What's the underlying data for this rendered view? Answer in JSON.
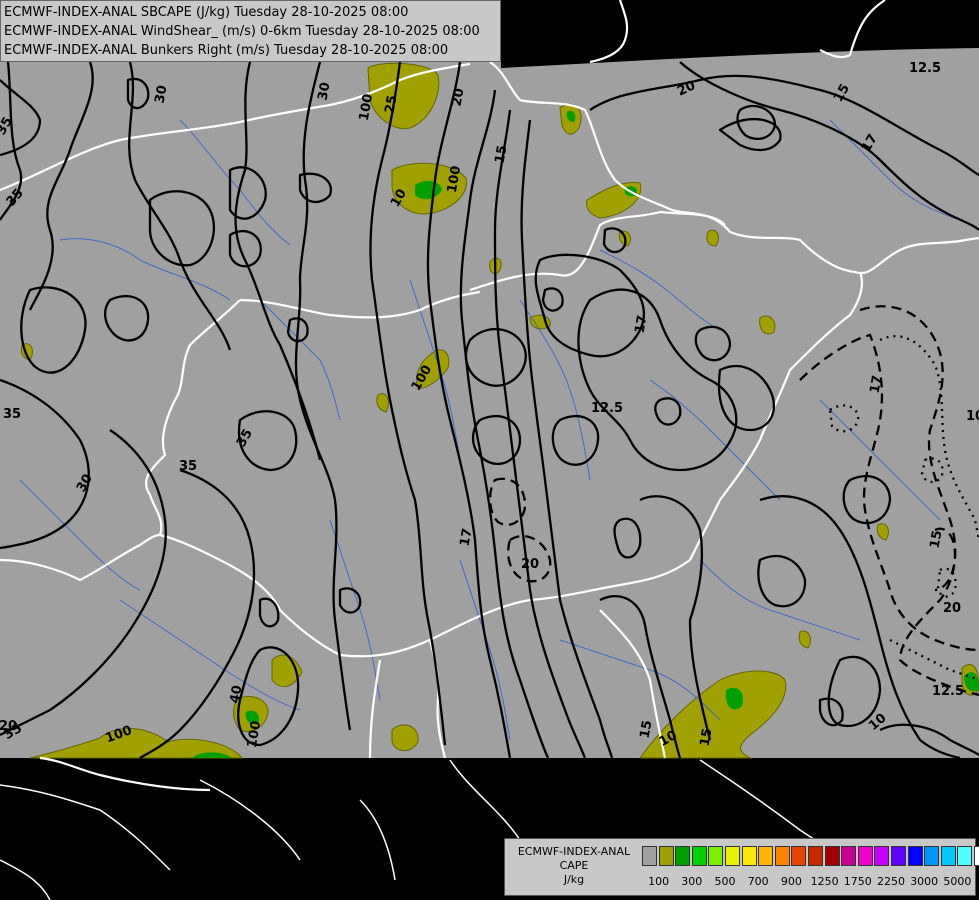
{
  "title_lines": [
    "ECMWF-INDEX-ANAL SBCAPE (J/kg) Tuesday 28-10-2025 08:00",
    "ECMWF-INDEX-ANAL WindShear_ (m/s) 0-6km Tuesday 28-10-2025 08:00",
    "ECMWF-INDEX-ANAL Bunkers Right (m/s) Tuesday 28-10-2025 08:00"
  ],
  "legend": {
    "title_lines": [
      "ECMWF-INDEX-ANAL",
      "CAPE",
      "J/kg"
    ],
    "colors": [
      "#a0a0a0",
      "#a0a000",
      "#00a000",
      "#00d200",
      "#78f000",
      "#e6f000",
      "#ffe600",
      "#ffb400",
      "#ff8200",
      "#e64600",
      "#c82800",
      "#a00000",
      "#c80096",
      "#f000c8",
      "#c800ff",
      "#6400ff",
      "#0000ff",
      "#0096ff",
      "#00c8ff",
      "#50ffff",
      "#ffffff"
    ],
    "tick_labels": [
      "100",
      "300",
      "500",
      "700",
      "900",
      "1250",
      "1750",
      "2250",
      "3000",
      "5000"
    ]
  },
  "contour_labels": {
    "shear": [
      "35",
      "35",
      "30",
      "30",
      "25",
      "20",
      "20",
      "15",
      "17",
      "12.5",
      "15",
      "17",
      "35",
      "35",
      "30",
      "35",
      "40",
      "35",
      "17",
      "20",
      "12.5",
      "15",
      "17",
      "15",
      "20",
      "10",
      "12.5",
      "10",
      "15",
      "20",
      "17"
    ],
    "cape": [
      "100",
      "10",
      "100",
      "100",
      "100",
      "10",
      "100"
    ]
  },
  "colors": {
    "map_fill": "#a0a0a0",
    "background": "#000000",
    "borders": "#ffffff",
    "rivers": "#3c64c8",
    "contours": "#000000",
    "cape_low": "#a0a000",
    "cape_mid": "#00a000"
  }
}
